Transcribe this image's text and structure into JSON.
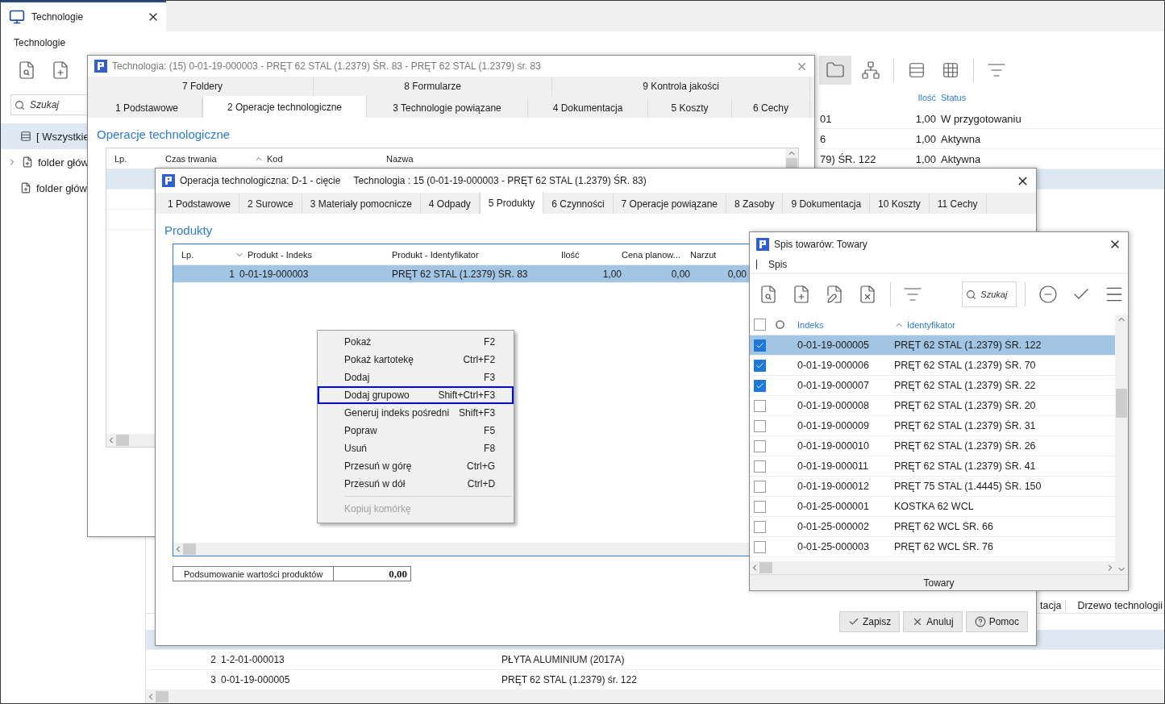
{
  "app_tab": {
    "title": "Technologie"
  },
  "main": {
    "title": "Technologie",
    "search": {
      "placeholder": "Szukaj"
    },
    "tree": [
      {
        "label": "[ Wszystkie",
        "kind": "all",
        "selected": true
      },
      {
        "label": "folder głów",
        "kind": "group",
        "selected": false
      },
      {
        "label": "folder głów",
        "kind": "folder",
        "selected": false
      }
    ],
    "columns": [
      "Ilość",
      "Status"
    ],
    "rows": [
      {
        "name": "01",
        "quantity": "1,00",
        "status": "W przygotowaniu",
        "selected": false
      },
      {
        "name": "6",
        "quantity": "1,00",
        "status": "Aktywna",
        "selected": false
      },
      {
        "name": "79) ŚR. 122",
        "quantity": "1,00",
        "status": "Aktywna",
        "selected": false
      },
      {
        "selected": true
      }
    ],
    "lower_tabs": [
      "tacja",
      "Drzewo technologii"
    ],
    "lower_rows": [
      {
        "selected": true
      },
      {
        "lp": "2",
        "index": "1-2-01-000013",
        "name": "PŁYTA ALUMINIUM (2017A)",
        "selected": false
      },
      {
        "lp": "3",
        "index": "0-01-19-000005",
        "name": "PRĘT 62 STAL (1.2379) śr. 122",
        "selected": false
      }
    ]
  },
  "technology_window": {
    "title": "Technologia: (15) 0-01-19-000003 - PRĘT 62 STAL (1.2379) ŚR. 83 - PRĘT 62 STAL (1.2379) śr. 83",
    "tab_rows": [
      [
        {
          "label": "7 Foldery",
          "selected": false
        },
        {
          "label": "8 Formularze",
          "selected": false
        },
        {
          "label": "9 Kontrola jakości",
          "selected": false
        }
      ],
      [
        {
          "label": "1 Podstawowe",
          "selected": false
        },
        {
          "label": "2 Operacje technologiczne",
          "selected": true
        },
        {
          "label": "3 Technologie powiązane",
          "selected": false
        },
        {
          "label": "4 Dokumentacja",
          "selected": false
        },
        {
          "label": "5 Koszty",
          "selected": false
        },
        {
          "label": "6 Cechy",
          "selected": false
        }
      ]
    ],
    "section": "Operacje technologiczne",
    "columns": [
      {
        "label": "Lp."
      },
      {
        "label": "Czas trwania"
      },
      {
        "label": "Kod",
        "sorted": true,
        "descending": false
      },
      {
        "label": "Nazwa"
      }
    ],
    "rows": [
      {
        "selected": true
      },
      {
        "selected": false
      },
      {
        "selected": false
      }
    ]
  },
  "operation_dialog": {
    "title": "Operacja technologiczna: D-1 - cięcie",
    "subtitle": "Technologia : 15 (0-01-19-000003 - PRĘT 62 STAL (1.2379) ŚR. 83)",
    "tabs": [
      {
        "label": "1 Podstawowe",
        "selected": false
      },
      {
        "label": "2 Surowce",
        "selected": false
      },
      {
        "label": "3 Materiały pomocnicze",
        "selected": false
      },
      {
        "label": "4 Odpady",
        "selected": false
      },
      {
        "label": "5 Produkty",
        "selected": true
      },
      {
        "label": "6 Czynności",
        "selected": false
      },
      {
        "label": "7 Operacje powiązane",
        "selected": false
      },
      {
        "label": "8 Zasoby",
        "selected": false
      },
      {
        "label": "9 Dokumentacja",
        "selected": false
      },
      {
        "label": "10 Koszty",
        "selected": false
      },
      {
        "label": "11 Cechy",
        "selected": false
      }
    ],
    "section": "Produkty",
    "columns": [
      {
        "label": "Lp."
      },
      {
        "label": "Produkt - Indeks",
        "sorted": true,
        "descending": true
      },
      {
        "label": "Produkt - Identyfikator"
      },
      {
        "label": "Ilość"
      },
      {
        "label": "Cena planow..."
      },
      {
        "label": "Narzut"
      }
    ],
    "rows": [
      {
        "lp": "1",
        "index": "0-01-19-000003",
        "name": "PRĘT 62 STAL (1.2379) ŚR. 83",
        "quantity": "1,00",
        "price": "0,00",
        "markup": "0,00",
        "selected": true
      }
    ],
    "summary": {
      "label": "Podsumowanie wartości produktów",
      "value": "0,00"
    },
    "buttons": [
      {
        "label": "Zapisz",
        "kind": "save"
      },
      {
        "label": "Anuluj",
        "kind": "cancel"
      },
      {
        "label": "Pomoc",
        "kind": "help"
      }
    ]
  },
  "context_menu": {
    "items": [
      {
        "label": "Pokaż",
        "shortcut": "F2",
        "focused": false,
        "disabled": false
      },
      {
        "label": "Pokaż kartotekę",
        "shortcut": "Ctrl+F2",
        "focused": false,
        "disabled": false
      },
      {
        "label": "Dodaj",
        "shortcut": "F3",
        "focused": false,
        "disabled": false
      },
      {
        "label": "Dodaj grupowo",
        "shortcut": "Shift+Ctrl+F3",
        "focused": true,
        "disabled": false
      },
      {
        "label": "Generuj indeks pośredni",
        "shortcut": "Shift+F3",
        "focused": false,
        "disabled": false
      },
      {
        "label": "Popraw",
        "shortcut": "F5",
        "focused": false,
        "disabled": false
      },
      {
        "label": "Usuń",
        "shortcut": "F8",
        "focused": false,
        "disabled": false
      },
      {
        "label": "Przesuń w górę",
        "shortcut": "Ctrl+G",
        "focused": false,
        "disabled": false
      },
      {
        "label": "Przesuń w dół",
        "shortcut": "Ctrl+D",
        "focused": false,
        "disabled": false
      },
      {
        "label": "Kopiuj komórkę",
        "separator_before": true,
        "focused": false,
        "disabled": true
      }
    ]
  },
  "goods_window": {
    "title": "Spis towarów: Towary",
    "tab": "Spis",
    "search": {
      "placeholder": "Szukaj"
    },
    "all_checked": false,
    "columns": [
      {
        "label": "Indeks"
      },
      {
        "label": "Identyfikator",
        "sorted": true,
        "descending": false
      }
    ],
    "rows": [
      {
        "index": "0-01-19-000005",
        "name": "PRĘT 62 STAL (1.2379) ŚR. 122",
        "checked": true,
        "selected": true
      },
      {
        "index": "0-01-19-000006",
        "name": "PRĘT 62 STAL (1.2379) ŚR. 70",
        "checked": true,
        "selected": false
      },
      {
        "index": "0-01-19-000007",
        "name": "PRĘT 62 STAL (1.2379) ŚR. 22",
        "checked": true,
        "selected": false
      },
      {
        "index": "0-01-19-000008",
        "name": "PRĘT 62 STAL (1.2379) ŚR. 20",
        "checked": false,
        "selected": false
      },
      {
        "index": "0-01-19-000009",
        "name": "PRĘT 62 STAL (1.2379) ŚR. 31",
        "checked": false,
        "selected": false
      },
      {
        "index": "0-01-19-000010",
        "name": "PRĘT 62 STAL (1.2379) ŚR. 26",
        "checked": false,
        "selected": false
      },
      {
        "index": "0-01-19-000011",
        "name": "PRĘT 62 STAL (1.2379) ŚR. 41",
        "checked": false,
        "selected": false
      },
      {
        "index": "0-01-19-000012",
        "name": "PRĘT 75 STAL (1.4445) ŚR. 150",
        "checked": false,
        "selected": false
      },
      {
        "index": "0-01-25-000001",
        "name": "KOSTKA 62 WCL",
        "checked": false,
        "selected": false
      },
      {
        "index": "0-01-25-000002",
        "name": "PRĘT 62 WCL ŚR. 66",
        "checked": false,
        "selected": false
      },
      {
        "index": "0-01-25-000003",
        "name": "PRĘT 62 WCL ŚR. 76",
        "checked": false,
        "selected": false
      }
    ],
    "footer": "Towary"
  }
}
